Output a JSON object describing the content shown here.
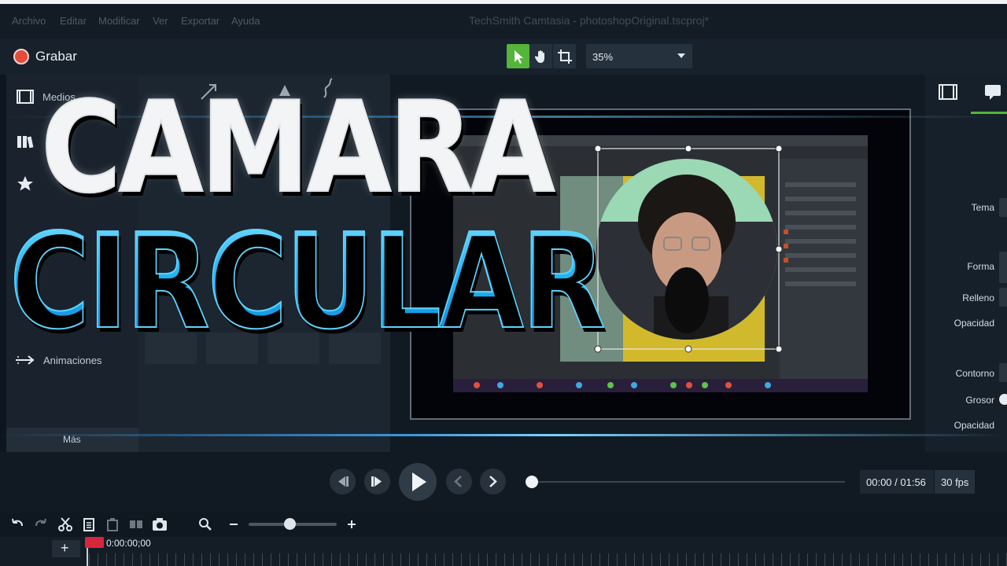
{
  "menubar": {
    "items": [
      "Archivo",
      "Editar",
      "Modificar",
      "Ver",
      "Exportar",
      "Ayuda"
    ],
    "window_title": "TechSmith Camtasia - photoshopOriginal.tscproj*"
  },
  "toolbar": {
    "record_label": "Grabar",
    "zoom_value": "35%"
  },
  "sidebar": {
    "items": [
      "Medios",
      "Animaciones"
    ],
    "more_label": "Más"
  },
  "headline": {
    "line1": "CAMARA",
    "line2": "CIRCULAR"
  },
  "properties": {
    "labels": [
      "Tema",
      "Forma",
      "Relleno",
      "Opacidad",
      "Contorno",
      "Grosor",
      "Opacidad"
    ]
  },
  "player": {
    "time": "00:00 / 01:56",
    "fps": "30 fps"
  },
  "timeline": {
    "playhead_time": "0:00:00;00"
  },
  "colors": {
    "accent_green": "#55b43a",
    "record_red": "#e74a3b",
    "headline_blue": "#22b4f2"
  }
}
